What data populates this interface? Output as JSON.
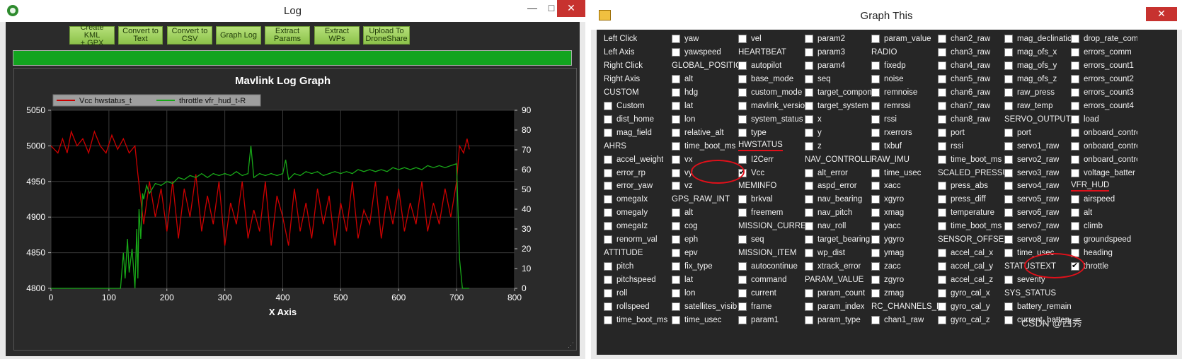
{
  "log_window": {
    "title": "Log",
    "minimize": "—",
    "maximize": "□",
    "close": "✕",
    "buttons": [
      {
        "line1": "Create KML",
        "line2": "+ GPX"
      },
      {
        "line1": "Convert to",
        "line2": "Text"
      },
      {
        "line1": "Convert to",
        "line2": "CSV"
      },
      {
        "line1": "Graph Log",
        "line2": ""
      },
      {
        "line1": "Extract",
        "line2": "Params"
      },
      {
        "line1": "Extract",
        "line2": "WPs"
      },
      {
        "line1": "Upload To",
        "line2": "DroneShare"
      }
    ],
    "progress": 1.0,
    "progress_color": "#12a41f"
  },
  "chart_data": {
    "type": "line",
    "title": "Mavlink Log Graph",
    "xlabel": "X Axis",
    "ylabel": "",
    "xlim": [
      0,
      800
    ],
    "ylim": [
      4800,
      5050
    ],
    "y2lim": [
      0,
      90
    ],
    "x_ticks": [
      "0",
      "100",
      "200",
      "300",
      "400",
      "500",
      "600",
      "700",
      "800"
    ],
    "y_ticks": [
      "4800",
      "4850",
      "4900",
      "4950",
      "5000",
      "5050"
    ],
    "y2_ticks": [
      "0",
      "10",
      "20",
      "30",
      "40",
      "50",
      "60",
      "70",
      "80",
      "90"
    ],
    "legend_position": "top-left",
    "grid": true,
    "series": [
      {
        "name": "Vcc hwstatus_t",
        "color": "#cc0000",
        "axis": "left",
        "approx_points": [
          [
            0,
            5000
          ],
          [
            12,
            4990
          ],
          [
            20,
            5010
          ],
          [
            28,
            4990
          ],
          [
            35,
            5020
          ],
          [
            45,
            5000
          ],
          [
            55,
            5010
          ],
          [
            65,
            4990
          ],
          [
            75,
            5020
          ],
          [
            85,
            5000
          ],
          [
            95,
            4990
          ],
          [
            105,
            5015
          ],
          [
            115,
            4995
          ],
          [
            125,
            5010
          ],
          [
            135,
            4990
          ],
          [
            145,
            5000
          ],
          [
            150,
            4960
          ],
          [
            160,
            4890
          ],
          [
            170,
            4950
          ],
          [
            180,
            4900
          ],
          [
            190,
            4940
          ],
          [
            200,
            4880
          ],
          [
            210,
            4950
          ],
          [
            220,
            4870
          ],
          [
            230,
            4940
          ],
          [
            240,
            4900
          ],
          [
            250,
            4960
          ],
          [
            260,
            4880
          ],
          [
            270,
            4930
          ],
          [
            280,
            4890
          ],
          [
            290,
            4950
          ],
          [
            300,
            4860
          ],
          [
            310,
            4920
          ],
          [
            320,
            4890
          ],
          [
            330,
            4950
          ],
          [
            340,
            4870
          ],
          [
            350,
            4910
          ],
          [
            360,
            4880
          ],
          [
            370,
            4950
          ],
          [
            380,
            4860
          ],
          [
            390,
            4930
          ],
          [
            400,
            4900
          ],
          [
            410,
            4860
          ],
          [
            420,
            4940
          ],
          [
            430,
            4880
          ],
          [
            440,
            4920
          ],
          [
            450,
            4870
          ],
          [
            460,
            4940
          ],
          [
            470,
            4890
          ],
          [
            480,
            4930
          ],
          [
            490,
            4860
          ],
          [
            500,
            4920
          ],
          [
            510,
            4880
          ],
          [
            520,
            4950
          ],
          [
            530,
            4870
          ],
          [
            540,
            4910
          ],
          [
            550,
            4890
          ],
          [
            560,
            4950
          ],
          [
            570,
            4870
          ],
          [
            580,
            4930
          ],
          [
            590,
            4890
          ],
          [
            600,
            4940
          ],
          [
            610,
            4880
          ],
          [
            620,
            4920
          ],
          [
            630,
            4890
          ],
          [
            640,
            4950
          ],
          [
            650,
            4880
          ],
          [
            660,
            4920
          ],
          [
            670,
            4890
          ],
          [
            680,
            4940
          ],
          [
            690,
            4900
          ],
          [
            700,
            4950
          ],
          [
            705,
            5000
          ],
          [
            712,
            4990
          ],
          [
            718,
            5010
          ],
          [
            722,
            4995
          ]
        ]
      },
      {
        "name": "throttle vfr_hud_t-R",
        "color": "#18a818",
        "axis": "right",
        "approx_points": [
          [
            0,
            0
          ],
          [
            120,
            0
          ],
          [
            125,
            18
          ],
          [
            128,
            5
          ],
          [
            132,
            25
          ],
          [
            135,
            8
          ],
          [
            140,
            20
          ],
          [
            145,
            0
          ],
          [
            148,
            30
          ],
          [
            150,
            5
          ],
          [
            152,
            40
          ],
          [
            155,
            25
          ],
          [
            158,
            48
          ],
          [
            160,
            45
          ],
          [
            165,
            52
          ],
          [
            170,
            48
          ],
          [
            180,
            53
          ],
          [
            190,
            52
          ],
          [
            200,
            54
          ],
          [
            210,
            53
          ],
          [
            220,
            56
          ],
          [
            230,
            55
          ],
          [
            240,
            57
          ],
          [
            250,
            56
          ],
          [
            260,
            58
          ],
          [
            270,
            56
          ],
          [
            280,
            58
          ],
          [
            290,
            57
          ],
          [
            300,
            58
          ],
          [
            310,
            57
          ],
          [
            320,
            59
          ],
          [
            330,
            57
          ],
          [
            340,
            58
          ],
          [
            345,
            72
          ],
          [
            350,
            56
          ],
          [
            360,
            58
          ],
          [
            370,
            57
          ],
          [
            380,
            58
          ],
          [
            390,
            57
          ],
          [
            400,
            58
          ],
          [
            405,
            65
          ],
          [
            410,
            55
          ],
          [
            420,
            58
          ],
          [
            430,
            57
          ],
          [
            440,
            59
          ],
          [
            450,
            58
          ],
          [
            460,
            59
          ],
          [
            470,
            57
          ],
          [
            480,
            58
          ],
          [
            490,
            59
          ],
          [
            500,
            58
          ],
          [
            510,
            59
          ],
          [
            520,
            58
          ],
          [
            530,
            60
          ],
          [
            540,
            59
          ],
          [
            550,
            60
          ],
          [
            560,
            59
          ],
          [
            570,
            60
          ],
          [
            580,
            59
          ],
          [
            590,
            61
          ],
          [
            600,
            60
          ],
          [
            610,
            61
          ],
          [
            620,
            60
          ],
          [
            630,
            61
          ],
          [
            640,
            60
          ],
          [
            650,
            62
          ],
          [
            660,
            61
          ],
          [
            670,
            62
          ],
          [
            680,
            61
          ],
          [
            690,
            62
          ],
          [
            700,
            63
          ],
          [
            705,
            15
          ],
          [
            710,
            0
          ],
          [
            722,
            0
          ]
        ]
      }
    ]
  },
  "graph_window": {
    "title": "Graph This",
    "close": "✕",
    "columns": [
      [
        {
          "t": "Left Click",
          "h": true
        },
        {
          "t": "Left Axis",
          "h": true
        },
        {
          "t": "Right Click",
          "h": true
        },
        {
          "t": "Right Axis",
          "h": true
        },
        {
          "t": "CUSTOM",
          "h": true
        },
        {
          "t": "Custom"
        },
        {
          "t": "dist_home"
        },
        {
          "t": "mag_field"
        },
        {
          "t": "AHRS",
          "h": true
        },
        {
          "t": "accel_weight"
        },
        {
          "t": "error_rp"
        },
        {
          "t": "error_yaw"
        },
        {
          "t": "omegaIx"
        },
        {
          "t": "omegaIy"
        },
        {
          "t": "omegaIz"
        },
        {
          "t": "renorm_val"
        },
        {
          "t": "ATTITUDE",
          "h": true
        },
        {
          "t": "pitch"
        },
        {
          "t": "pitchspeed"
        },
        {
          "t": "roll"
        },
        {
          "t": "rollspeed"
        },
        {
          "t": "time_boot_ms"
        }
      ],
      [
        {
          "t": "yaw"
        },
        {
          "t": "yawspeed"
        },
        {
          "t": "GLOBAL_POSITIO",
          "h": true
        },
        {
          "t": "alt"
        },
        {
          "t": "hdg"
        },
        {
          "t": "lat"
        },
        {
          "t": "lon"
        },
        {
          "t": "relative_alt"
        },
        {
          "t": "time_boot_ms"
        },
        {
          "t": "vx"
        },
        {
          "t": "vy"
        },
        {
          "t": "vz"
        },
        {
          "t": "GPS_RAW_INT",
          "h": true
        },
        {
          "t": "alt"
        },
        {
          "t": "cog"
        },
        {
          "t": "eph"
        },
        {
          "t": "epv"
        },
        {
          "t": "fix_type"
        },
        {
          "t": "lat"
        },
        {
          "t": "lon"
        },
        {
          "t": "satellites_visib"
        },
        {
          "t": "time_usec"
        }
      ],
      [
        {
          "t": "vel"
        },
        {
          "t": "HEARTBEAT",
          "h": true
        },
        {
          "t": "autopilot"
        },
        {
          "t": "base_mode"
        },
        {
          "t": "custom_mode"
        },
        {
          "t": "mavlink_versio"
        },
        {
          "t": "system_status"
        },
        {
          "t": "type"
        },
        {
          "t": "HWSTATUS",
          "h": true,
          "u": true
        },
        {
          "t": "I2Cerr"
        },
        {
          "t": "Vcc",
          "checked": true
        },
        {
          "t": "MEMINFO",
          "h": true
        },
        {
          "t": "brkval"
        },
        {
          "t": "freemem"
        },
        {
          "t": "MISSION_CURRE",
          "h": true
        },
        {
          "t": "seq"
        },
        {
          "t": "MISSION_ITEM",
          "h": true
        },
        {
          "t": "autocontinue"
        },
        {
          "t": "command"
        },
        {
          "t": "current"
        },
        {
          "t": "frame"
        },
        {
          "t": "param1"
        }
      ],
      [
        {
          "t": "param2"
        },
        {
          "t": "param3"
        },
        {
          "t": "param4"
        },
        {
          "t": "seq"
        },
        {
          "t": "target_compon"
        },
        {
          "t": "target_system"
        },
        {
          "t": "x"
        },
        {
          "t": "y"
        },
        {
          "t": "z"
        },
        {
          "t": "NAV_CONTROLLE",
          "h": true
        },
        {
          "t": "alt_error"
        },
        {
          "t": "aspd_error"
        },
        {
          "t": "nav_bearing"
        },
        {
          "t": "nav_pitch"
        },
        {
          "t": "nav_roll"
        },
        {
          "t": "target_bearing"
        },
        {
          "t": "wp_dist"
        },
        {
          "t": "xtrack_error"
        },
        {
          "t": "PARAM_VALUE",
          "h": true
        },
        {
          "t": "param_count"
        },
        {
          "t": "param_index"
        },
        {
          "t": "param_type"
        }
      ],
      [
        {
          "t": "param_value"
        },
        {
          "t": "RADIO",
          "h": true
        },
        {
          "t": "fixedp"
        },
        {
          "t": "noise"
        },
        {
          "t": "remnoise"
        },
        {
          "t": "remrssi"
        },
        {
          "t": "rssi"
        },
        {
          "t": "rxerrors"
        },
        {
          "t": "txbuf"
        },
        {
          "t": "RAW_IMU",
          "h": true
        },
        {
          "t": "time_usec"
        },
        {
          "t": "xacc"
        },
        {
          "t": "xgyro"
        },
        {
          "t": "xmag"
        },
        {
          "t": "yacc"
        },
        {
          "t": "ygyro"
        },
        {
          "t": "ymag"
        },
        {
          "t": "zacc"
        },
        {
          "t": "zgyro"
        },
        {
          "t": "zmag"
        },
        {
          "t": "RC_CHANNELS_R",
          "h": true
        },
        {
          "t": "chan1_raw"
        }
      ],
      [
        {
          "t": "chan2_raw"
        },
        {
          "t": "chan3_raw"
        },
        {
          "t": "chan4_raw"
        },
        {
          "t": "chan5_raw"
        },
        {
          "t": "chan6_raw"
        },
        {
          "t": "chan7_raw"
        },
        {
          "t": "chan8_raw"
        },
        {
          "t": "port"
        },
        {
          "t": "rssi"
        },
        {
          "t": "time_boot_ms"
        },
        {
          "t": "SCALED_PRESSU",
          "h": true
        },
        {
          "t": "press_abs"
        },
        {
          "t": "press_diff"
        },
        {
          "t": "temperature"
        },
        {
          "t": "time_boot_ms"
        },
        {
          "t": "SENSOR_OFFSET",
          "h": true
        },
        {
          "t": "accel_cal_x"
        },
        {
          "t": "accel_cal_y"
        },
        {
          "t": "accel_cal_z"
        },
        {
          "t": "gyro_cal_x"
        },
        {
          "t": "gyro_cal_y"
        },
        {
          "t": "gyro_cal_z"
        }
      ],
      [
        {
          "t": "mag_declinatio"
        },
        {
          "t": "mag_ofs_x"
        },
        {
          "t": "mag_ofs_y"
        },
        {
          "t": "mag_ofs_z"
        },
        {
          "t": "raw_press"
        },
        {
          "t": "raw_temp"
        },
        {
          "t": "SERVO_OUTPUT_",
          "h": true
        },
        {
          "t": "port"
        },
        {
          "t": "servo1_raw"
        },
        {
          "t": "servo2_raw"
        },
        {
          "t": "servo3_raw"
        },
        {
          "t": "servo4_raw"
        },
        {
          "t": "servo5_raw"
        },
        {
          "t": "servo6_raw"
        },
        {
          "t": "servo7_raw"
        },
        {
          "t": "servo8_raw"
        },
        {
          "t": "time_usec"
        },
        {
          "t": "STATUSTEXT",
          "h": true
        },
        {
          "t": "severity"
        },
        {
          "t": "SYS_STATUS",
          "h": true
        },
        {
          "t": "battery_remain"
        },
        {
          "t": "current_battery"
        }
      ],
      [
        {
          "t": "drop_rate_com"
        },
        {
          "t": "errors_comm"
        },
        {
          "t": "errors_count1"
        },
        {
          "t": "errors_count2"
        },
        {
          "t": "errors_count3"
        },
        {
          "t": "errors_count4"
        },
        {
          "t": "load"
        },
        {
          "t": "onboard_contro"
        },
        {
          "t": "onboard_contro"
        },
        {
          "t": "onboard_contro"
        },
        {
          "t": "voltage_batter"
        },
        {
          "t": "VFR_HUD",
          "h": true,
          "u": true
        },
        {
          "t": "airspeed"
        },
        {
          "t": "alt"
        },
        {
          "t": "climb"
        },
        {
          "t": "groundspeed"
        },
        {
          "t": "heading"
        },
        {
          "t": "throttle",
          "checked": true
        }
      ]
    ]
  },
  "watermark": "CSDN @西秀"
}
